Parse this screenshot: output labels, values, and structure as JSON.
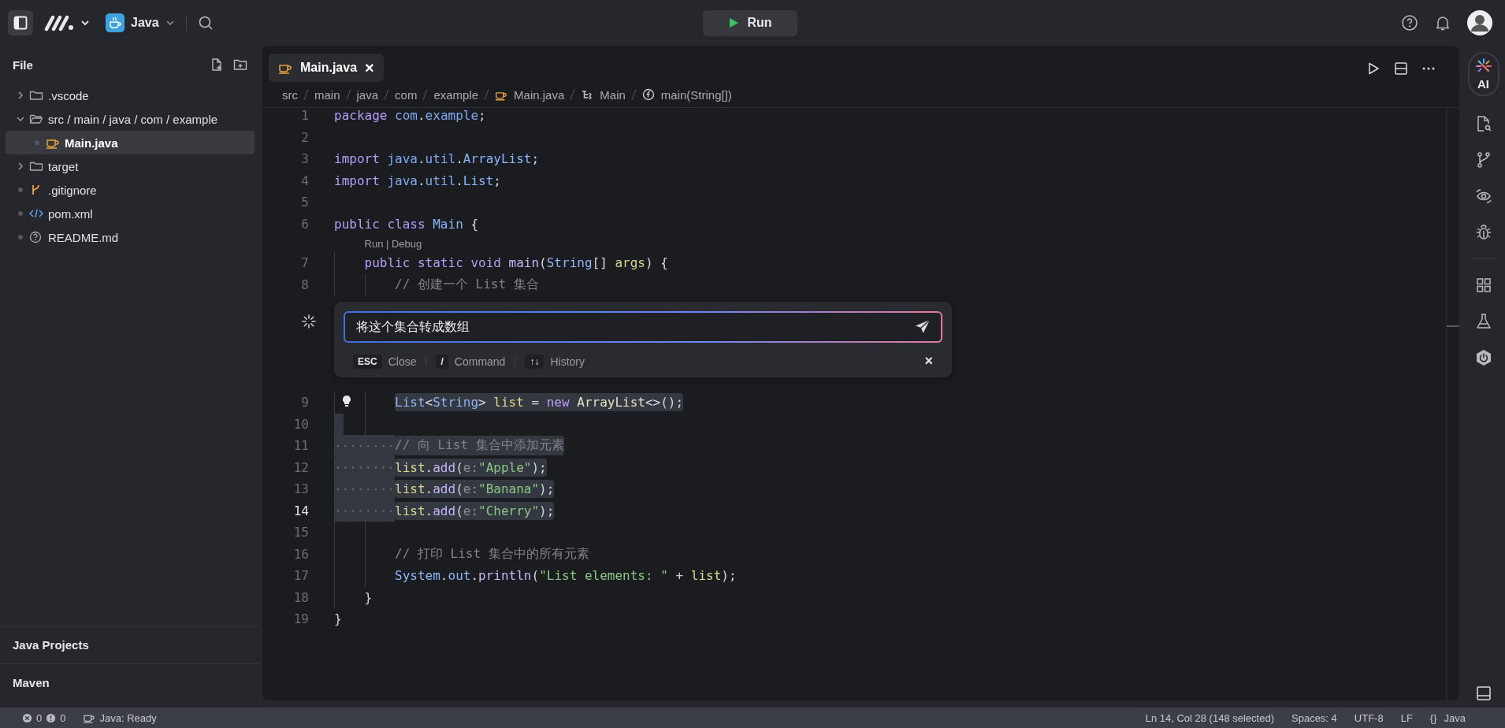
{
  "topbar": {
    "project": "Java",
    "run_button": "Run"
  },
  "sidebar": {
    "title": "File",
    "tree": [
      {
        "label": ".vscode",
        "kind": "folder",
        "expanded": false,
        "selected": false
      },
      {
        "label": "src / main / java / com / example",
        "kind": "folder",
        "expanded": true,
        "selected": false,
        "children": [
          {
            "label": "Main.java",
            "kind": "java",
            "selected": true
          }
        ]
      },
      {
        "label": "target",
        "kind": "folder",
        "expanded": false,
        "selected": false
      },
      {
        "label": ".gitignore",
        "kind": "git",
        "selected": false
      },
      {
        "label": "pom.xml",
        "kind": "xml",
        "selected": false
      },
      {
        "label": "README.md",
        "kind": "readme",
        "selected": false
      }
    ],
    "sections": [
      {
        "label": "Java Projects"
      },
      {
        "label": "Maven"
      }
    ]
  },
  "editor": {
    "tabs": [
      {
        "label": "Main.java",
        "selected": true,
        "close": "×"
      }
    ],
    "breadcrumbs": [
      {
        "label": "src",
        "kind": "folder"
      },
      {
        "label": "main",
        "kind": "folder"
      },
      {
        "label": "java",
        "kind": "folder"
      },
      {
        "label": "com",
        "kind": "folder"
      },
      {
        "label": "example",
        "kind": "folder"
      },
      {
        "label": "Main.java",
        "kind": "file"
      },
      {
        "label": "Main",
        "kind": "class"
      },
      {
        "label": "main(String[])",
        "kind": "method"
      }
    ],
    "lines": [
      {
        "kind": "code",
        "number": "1",
        "current": false,
        "selected": false,
        "tokens": [
          {
            "kind": "keyword",
            "text": "package "
          },
          {
            "kind": "namespace",
            "text": "com"
          },
          {
            "kind": "plain",
            "text": "."
          },
          {
            "kind": "namespace",
            "text": "example"
          },
          {
            "kind": "plain",
            "text": ";"
          }
        ]
      },
      {
        "kind": "code",
        "number": "2",
        "current": false,
        "selected": false
      },
      {
        "kind": "code",
        "number": "3",
        "current": false,
        "selected": false,
        "tokens": [
          {
            "kind": "keyword",
            "text": "import "
          },
          {
            "kind": "namespace",
            "text": "java"
          },
          {
            "kind": "plain",
            "text": "."
          },
          {
            "kind": "namespace",
            "text": "util"
          },
          {
            "kind": "plain",
            "text": "."
          },
          {
            "kind": "type",
            "text": "ArrayList"
          },
          {
            "kind": "plain",
            "text": ";"
          }
        ]
      },
      {
        "kind": "code",
        "number": "4",
        "current": false,
        "selected": false,
        "tokens": [
          {
            "kind": "keyword",
            "text": "import "
          },
          {
            "kind": "namespace",
            "text": "java"
          },
          {
            "kind": "plain",
            "text": "."
          },
          {
            "kind": "namespace",
            "text": "util"
          },
          {
            "kind": "plain",
            "text": "."
          },
          {
            "kind": "type",
            "text": "List"
          },
          {
            "kind": "plain",
            "text": ";"
          }
        ]
      },
      {
        "kind": "code",
        "number": "5",
        "current": false,
        "selected": false
      },
      {
        "kind": "code",
        "number": "6",
        "current": false,
        "selected": false,
        "tokens": [
          {
            "kind": "keyword",
            "text": "public class "
          },
          {
            "kind": "type",
            "text": "Main"
          },
          {
            "kind": "plain",
            "text": " {"
          }
        ],
        "children": [
          {
            "kind": "codelens",
            "text": "Run | Debug"
          },
          {
            "kind": "code",
            "number": "7",
            "current": false,
            "selected": false,
            "tokens": [
              {
                "kind": "keyword",
                "text": "public static void "
              },
              {
                "kind": "method",
                "text": "main"
              },
              {
                "kind": "plain",
                "text": "("
              },
              {
                "kind": "type",
                "text": "String"
              },
              {
                "kind": "plain",
                "text": "[] "
              },
              {
                "kind": "variable",
                "text": "args"
              },
              {
                "kind": "plain",
                "text": ") {"
              }
            ],
            "children": [
              {
                "kind": "code",
                "number": "8",
                "current": false,
                "selected": false,
                "tokens": [
                  {
                    "kind": "comment",
                    "text": "// 创建一个 List 集合"
                  }
                ]
              },
              {
                "kind": "inline_chat",
                "value": "将这个集合转成数组",
                "hints": [
                  {
                    "key": "ESC",
                    "label": "Close"
                  },
                  {
                    "key": "/",
                    "label": "Command"
                  },
                  {
                    "key": "↑↓",
                    "label": "History"
                  }
                ],
                "close": "×"
              },
              {
                "kind": "code",
                "number": "9",
                "current": false,
                "selected": true,
                "code_action": true,
                "tokens": [
                  {
                    "kind": "type",
                    "text": "List"
                  },
                  {
                    "kind": "plain",
                    "text": "<"
                  },
                  {
                    "kind": "type",
                    "text": "String"
                  },
                  {
                    "kind": "plain",
                    "text": "> "
                  },
                  {
                    "kind": "variable",
                    "text": "list"
                  },
                  {
                    "kind": "plain",
                    "text": " = "
                  },
                  {
                    "kind": "keyword",
                    "text": "new "
                  },
                  {
                    "kind": "constructor",
                    "text": "ArrayList"
                  },
                  {
                    "kind": "plain",
                    "text": "<>();"
                  }
                ]
              },
              {
                "kind": "code",
                "number": "10",
                "current": false,
                "selected": true
              },
              {
                "kind": "code",
                "number": "11",
                "current": false,
                "selected": true,
                "tokens": [
                  {
                    "kind": "comment",
                    "text": "// 向 List 集合中添加元素"
                  }
                ]
              },
              {
                "kind": "code",
                "number": "12",
                "current": false,
                "selected": true,
                "tokens": [
                  {
                    "kind": "variable",
                    "text": "list"
                  },
                  {
                    "kind": "plain",
                    "text": "."
                  },
                  {
                    "kind": "method",
                    "text": "add"
                  },
                  {
                    "kind": "plain",
                    "text": "("
                  },
                  {
                    "kind": "hint",
                    "text": "e:"
                  },
                  {
                    "kind": "string",
                    "text": "\"Apple\""
                  },
                  {
                    "kind": "plain",
                    "text": ");"
                  }
                ]
              },
              {
                "kind": "code",
                "number": "13",
                "current": false,
                "selected": true,
                "tokens": [
                  {
                    "kind": "variable",
                    "text": "list"
                  },
                  {
                    "kind": "plain",
                    "text": "."
                  },
                  {
                    "kind": "method",
                    "text": "add"
                  },
                  {
                    "kind": "plain",
                    "text": "("
                  },
                  {
                    "kind": "hint",
                    "text": "e:"
                  },
                  {
                    "kind": "string",
                    "text": "\"Banana\""
                  },
                  {
                    "kind": "plain",
                    "text": ");"
                  }
                ]
              },
              {
                "kind": "code",
                "number": "14",
                "current": true,
                "selected": true,
                "tokens": [
                  {
                    "kind": "variable",
                    "text": "list"
                  },
                  {
                    "kind": "plain",
                    "text": "."
                  },
                  {
                    "kind": "method",
                    "text": "add"
                  },
                  {
                    "kind": "plain",
                    "text": "("
                  },
                  {
                    "kind": "hint",
                    "text": "e:"
                  },
                  {
                    "kind": "string",
                    "text": "\"Cherry\""
                  },
                  {
                    "kind": "plain",
                    "text": ");"
                  }
                ]
              },
              {
                "kind": "code",
                "number": "15",
                "current": false,
                "selected": false
              },
              {
                "kind": "code",
                "number": "16",
                "current": false,
                "selected": false,
                "tokens": [
                  {
                    "kind": "comment",
                    "text": "// 打印 List 集合中的所有元素"
                  }
                ]
              },
              {
                "kind": "code",
                "number": "17",
                "current": false,
                "selected": false,
                "tokens": [
                  {
                    "kind": "type",
                    "text": "System"
                  },
                  {
                    "kind": "plain",
                    "text": "."
                  },
                  {
                    "kind": "field",
                    "text": "out"
                  },
                  {
                    "kind": "plain",
                    "text": "."
                  },
                  {
                    "kind": "method",
                    "text": "println"
                  },
                  {
                    "kind": "plain",
                    "text": "("
                  },
                  {
                    "kind": "string",
                    "text": "\"List elements: \""
                  },
                  {
                    "kind": "plain",
                    "text": " + "
                  },
                  {
                    "kind": "variable",
                    "text": "list"
                  },
                  {
                    "kind": "plain",
                    "text": ");"
                  }
                ]
              }
            ]
          },
          {
            "kind": "code",
            "number": "18",
            "current": false,
            "selected": false,
            "tokens": [
              {
                "kind": "plain",
                "text": "}"
              }
            ]
          }
        ]
      },
      {
        "kind": "code",
        "number": "19",
        "current": false,
        "selected": false,
        "tokens": [
          {
            "kind": "plain",
            "text": "}"
          }
        ]
      }
    ]
  },
  "activity_bar": {
    "ai_label": "AI"
  },
  "status_bar": {
    "errors": "0",
    "warnings": "0",
    "java_status": "Java: Ready",
    "position": "Ln 14, Col 28 (148 selected)",
    "spaces": "Spaces: 4",
    "encoding": "UTF-8",
    "eol": "LF",
    "language_icon": "{}",
    "language": "Java"
  }
}
